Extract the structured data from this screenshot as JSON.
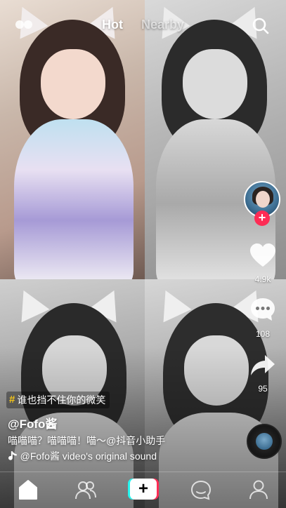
{
  "header": {
    "tabs": [
      {
        "label": "Hot",
        "active": true
      },
      {
        "label": "Nearby",
        "active": false
      }
    ],
    "icons": {
      "left": "live-icon",
      "right": "search-icon"
    }
  },
  "creator": {
    "avatar": "avatar-image",
    "follow_label": "+"
  },
  "actions": {
    "likes": "4.9k",
    "comments": "108",
    "shares": "95"
  },
  "post": {
    "hashtag": "谁也挡不住你的微笑",
    "username": "@Fofo酱",
    "description": "喵喵喵？喵喵喵！喵～@抖音小助手",
    "music": "@Fofo酱 video's original sound"
  },
  "bottom_nav": {
    "items": [
      {
        "name": "home",
        "icon": "home-icon",
        "active": true
      },
      {
        "name": "friends",
        "icon": "friends-icon"
      },
      {
        "name": "add",
        "icon": "plus-icon",
        "label": "+"
      },
      {
        "name": "inbox",
        "icon": "message-icon"
      },
      {
        "name": "me",
        "icon": "profile-icon"
      }
    ]
  },
  "colors": {
    "accent_red": "#fe2c55",
    "accent_cyan": "#25f4ee",
    "hashtag_yellow": "#f5c518"
  }
}
